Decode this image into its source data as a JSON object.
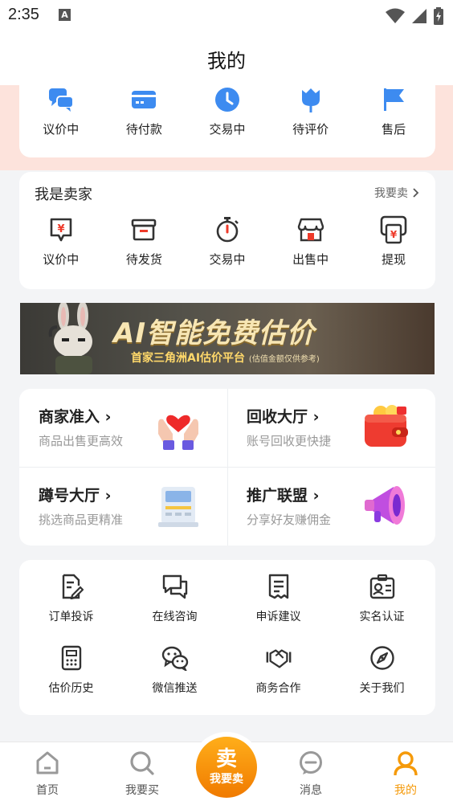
{
  "status_bar": {
    "time": "2:35",
    "notification_badge": "A"
  },
  "header": {
    "title": "我的"
  },
  "orders": {
    "items": [
      {
        "label": "议价中",
        "icon": "chat-bubbles-icon"
      },
      {
        "label": "待付款",
        "icon": "card-icon"
      },
      {
        "label": "交易中",
        "icon": "clock-icon"
      },
      {
        "label": "待评价",
        "icon": "tulip-icon"
      },
      {
        "label": "售后",
        "icon": "flag-icon"
      }
    ]
  },
  "seller": {
    "title": "我是卖家",
    "link_label": "我要卖",
    "items": [
      {
        "label": "议价中",
        "icon": "yen-bubble-icon"
      },
      {
        "label": "待发货",
        "icon": "box-icon"
      },
      {
        "label": "交易中",
        "icon": "stopwatch-icon"
      },
      {
        "label": "出售中",
        "icon": "shop-icon"
      },
      {
        "label": "提现",
        "icon": "yen-machine-icon"
      }
    ]
  },
  "banner": {
    "headline": "AI智能免费估价",
    "subline": "首家三角洲AI估价平台",
    "note": "(估值金额仅供参考)"
  },
  "features": [
    {
      "title": "商家准入",
      "subtitle": "商品出售更高效",
      "icon": "heart-hands-icon"
    },
    {
      "title": "回收大厅",
      "subtitle": "账号回收更快捷",
      "icon": "wallet-icon"
    },
    {
      "title": "蹲号大厅",
      "subtitle": "挑选商品更精准",
      "icon": "register-icon"
    },
    {
      "title": "推广联盟",
      "subtitle": "分享好友赚佣金",
      "icon": "megaphone-icon"
    }
  ],
  "services": [
    {
      "label": "订单投诉",
      "icon": "edit-document-icon"
    },
    {
      "label": "在线咨询",
      "icon": "chat-icon"
    },
    {
      "label": "申诉建议",
      "icon": "receipt-icon"
    },
    {
      "label": "实名认证",
      "icon": "id-card-icon"
    },
    {
      "label": "估价历史",
      "icon": "calculator-icon"
    },
    {
      "label": "微信推送",
      "icon": "wechat-icon"
    },
    {
      "label": "商务合作",
      "icon": "handshake-icon"
    },
    {
      "label": "关于我们",
      "icon": "compass-icon"
    }
  ],
  "tabbar": {
    "items": [
      {
        "label": "首页",
        "icon": "home-icon"
      },
      {
        "label": "我要买",
        "icon": "search-icon"
      },
      {
        "label": "消息",
        "icon": "message-icon"
      },
      {
        "label": "我的",
        "icon": "user-icon"
      }
    ],
    "sell_big": "卖",
    "sell_small": "我要卖",
    "active": "我的"
  },
  "colors": {
    "accent": "#f59a0a",
    "blue": "#3d8bf0",
    "text": "#222222",
    "muted": "#999999",
    "pink_band": "#fde3dc"
  }
}
